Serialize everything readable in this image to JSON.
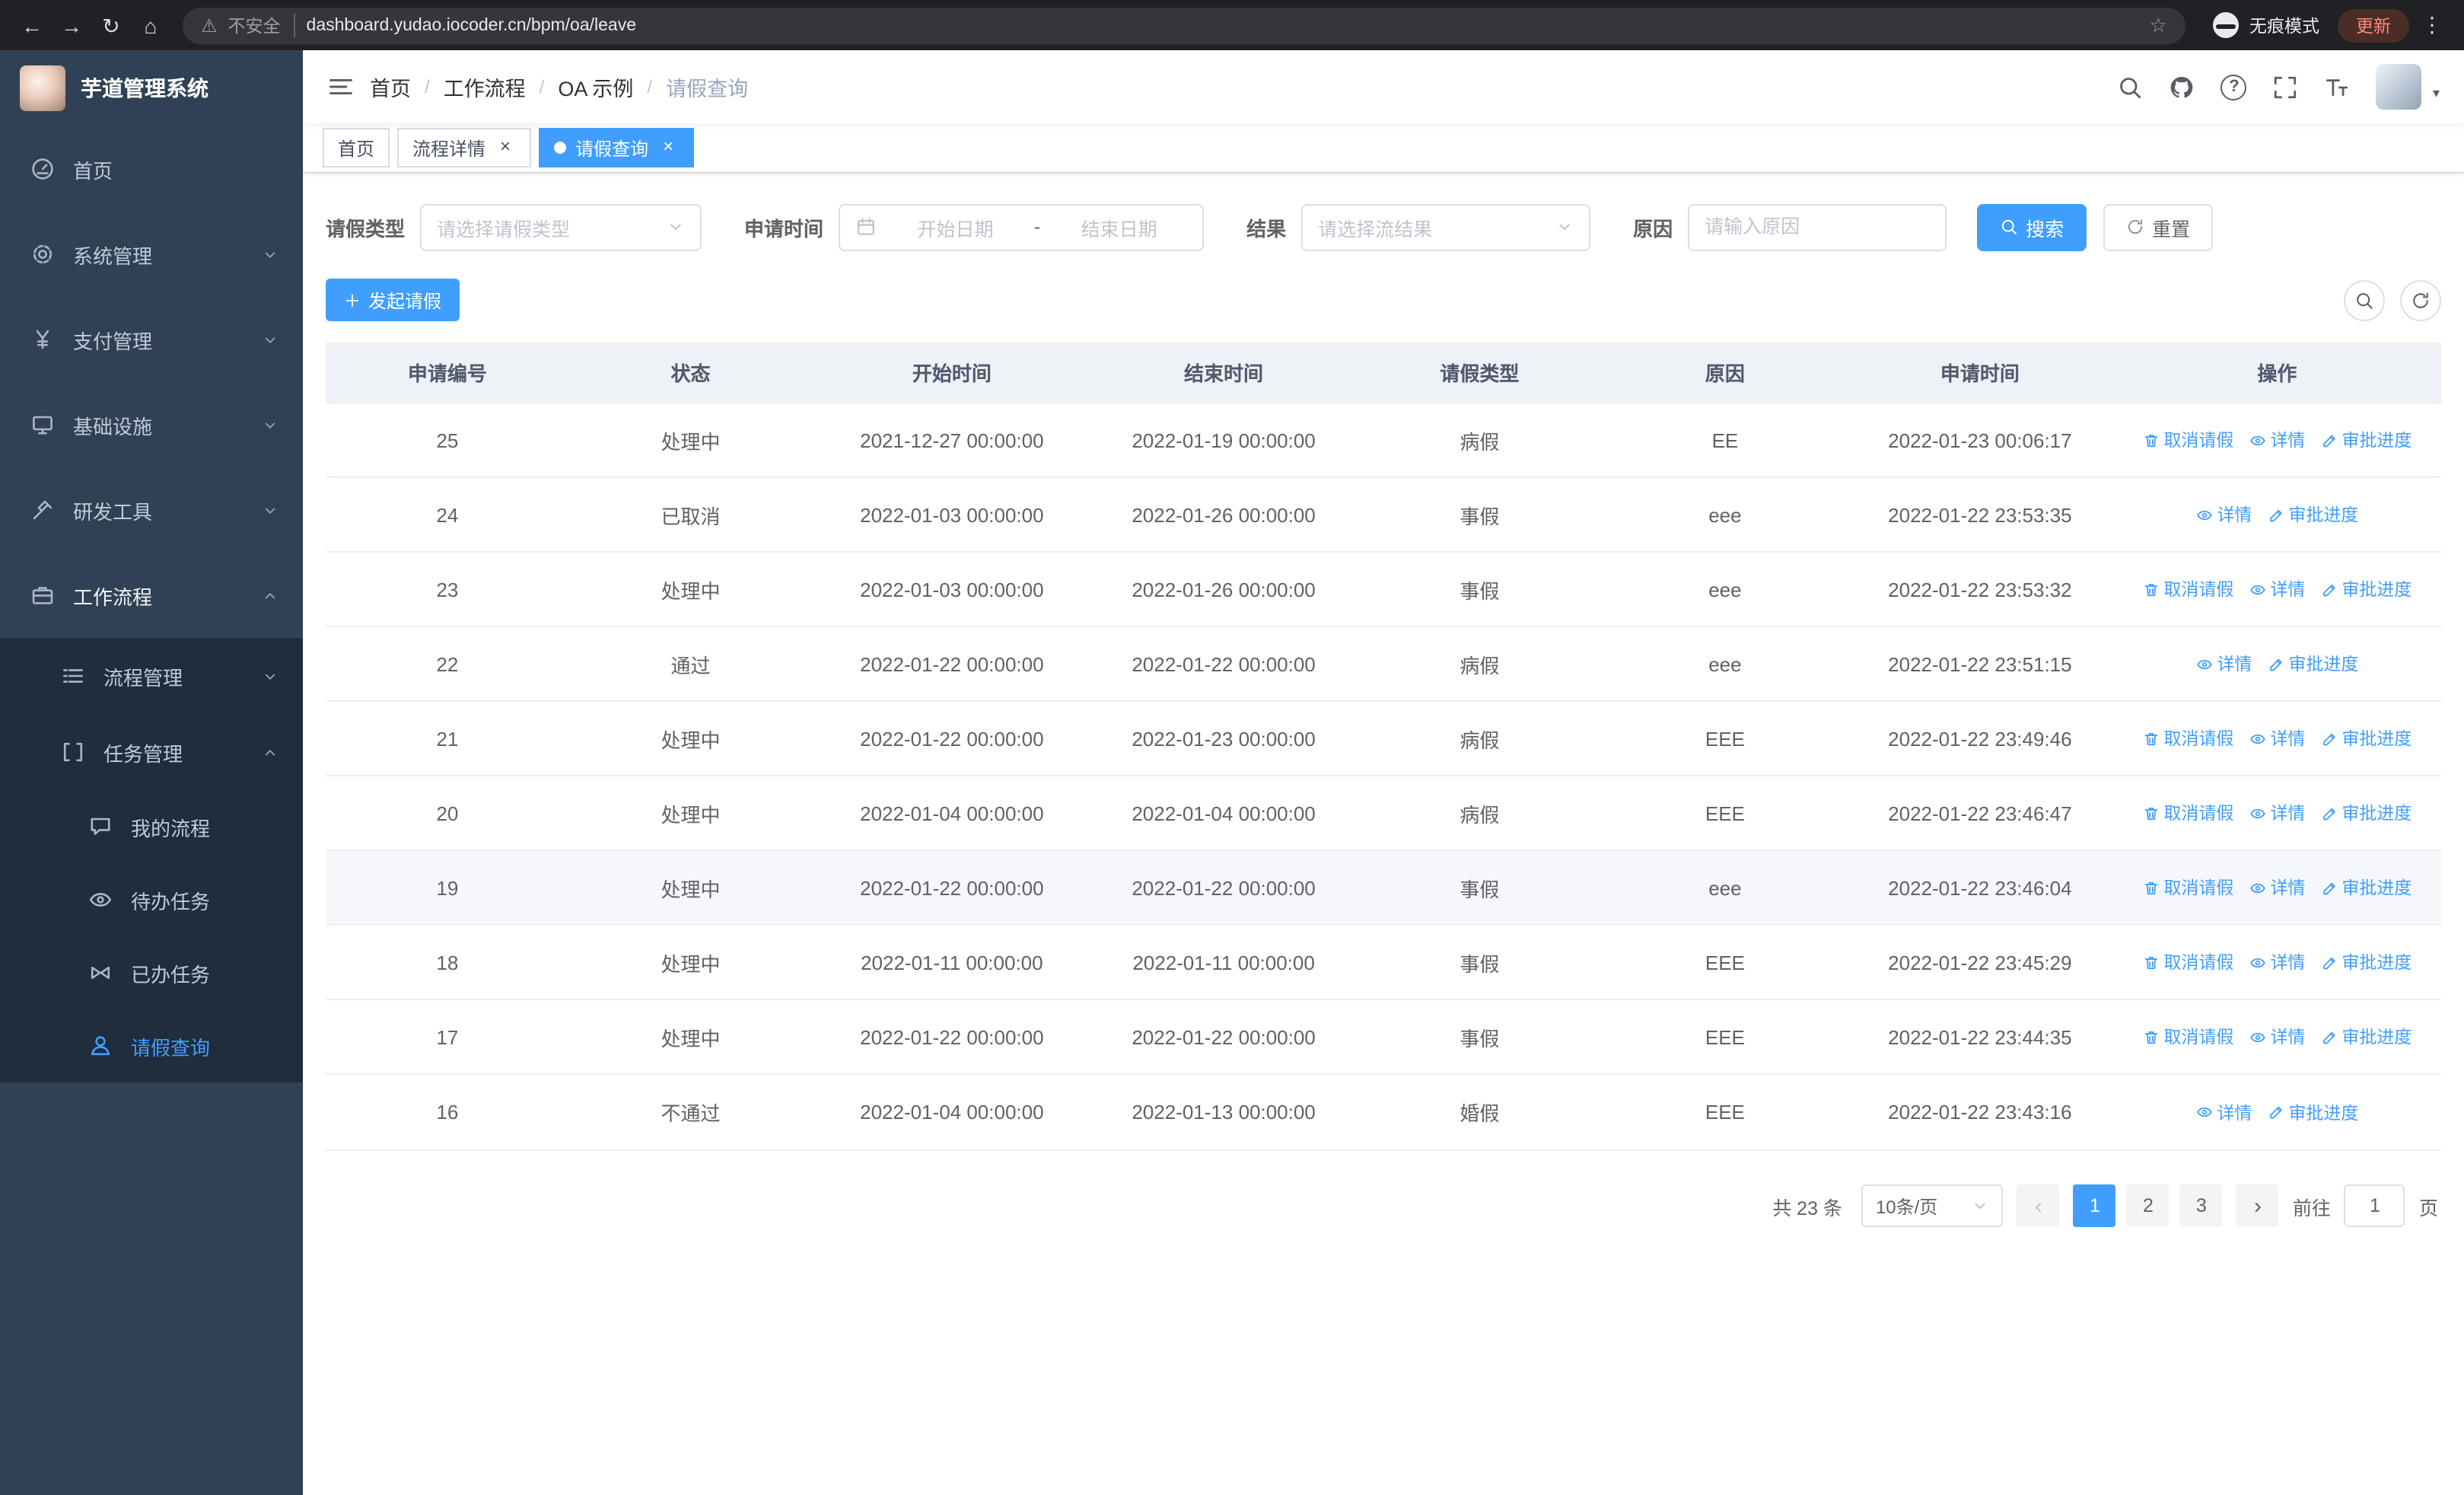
{
  "browser": {
    "security_warning": "不安全",
    "url": "dashboard.yudao.iocoder.cn/bpm/oa/leave",
    "incognito_label": "无痕模式",
    "update_button": "更新"
  },
  "sidebar": {
    "logo_title": "芋道管理系统",
    "menu": [
      {
        "key": "home",
        "label": "首页",
        "icon": "dashboard-icon"
      },
      {
        "key": "system-management",
        "label": "系统管理",
        "icon": "gear-icon",
        "chevron": "down"
      },
      {
        "key": "payment-management",
        "label": "支付管理",
        "icon": "yen-icon",
        "chevron": "down"
      },
      {
        "key": "infrastructure",
        "label": "基础设施",
        "icon": "monitor-icon",
        "chevron": "down"
      },
      {
        "key": "dev-tools",
        "label": "研发工具",
        "icon": "tools-icon",
        "chevron": "down"
      },
      {
        "key": "workflow",
        "label": "工作流程",
        "icon": "briefcase-icon",
        "chevron": "up",
        "highlight": true,
        "children": [
          {
            "key": "process-management",
            "label": "流程管理",
            "icon": "list-icon",
            "chevron": "down"
          },
          {
            "key": "task-management",
            "label": "任务管理",
            "icon": "bracket-icon",
            "chevron": "up",
            "children": [
              {
                "key": "my-process",
                "label": "我的流程",
                "icon": "chat-icon"
              },
              {
                "key": "todo-tasks",
                "label": "待办任务",
                "icon": "eye-icon"
              },
              {
                "key": "done-tasks",
                "label": "已办任务",
                "icon": "bowtie-icon"
              },
              {
                "key": "leave-query",
                "label": "请假查询",
                "icon": "user-icon",
                "active": true
              }
            ]
          }
        ]
      }
    ]
  },
  "header": {
    "breadcrumb": [
      "首页",
      "工作流程",
      "OA 示例",
      "请假查询"
    ]
  },
  "tabs": [
    {
      "key": "home",
      "label": "首页",
      "active": false,
      "closable": false
    },
    {
      "key": "process-detail",
      "label": "流程详情",
      "active": false,
      "closable": true
    },
    {
      "key": "leave-query",
      "label": "请假查询",
      "active": true,
      "closable": true
    }
  ],
  "filters": {
    "leave_type_label": "请假类型",
    "leave_type_placeholder": "请选择请假类型",
    "apply_time_label": "申请时间",
    "date_start_placeholder": "开始日期",
    "date_separator": "-",
    "date_end_placeholder": "结束日期",
    "result_label": "结果",
    "result_placeholder": "请选择流结果",
    "reason_label": "原因",
    "reason_placeholder": "请输入原因",
    "search_button": "搜索",
    "reset_button": "重置"
  },
  "toolbar": {
    "create_button": "发起请假"
  },
  "table": {
    "columns": [
      "申请编号",
      "状态",
      "开始时间",
      "结束时间",
      "请假类型",
      "原因",
      "申请时间",
      "操作"
    ],
    "action_labels": {
      "cancel": "取消请假",
      "detail": "详情",
      "progress": "审批进度"
    },
    "rows": [
      {
        "id": "25",
        "status": "处理中",
        "start": "2021-12-27 00:00:00",
        "end": "2022-01-19 00:00:00",
        "type": "病假",
        "reason": "EE",
        "apply_time": "2022-01-23 00:06:17",
        "actions": [
          "cancel",
          "detail",
          "progress"
        ]
      },
      {
        "id": "24",
        "status": "已取消",
        "start": "2022-01-03 00:00:00",
        "end": "2022-01-26 00:00:00",
        "type": "事假",
        "reason": "eee",
        "apply_time": "2022-01-22 23:53:35",
        "actions": [
          "detail",
          "progress"
        ]
      },
      {
        "id": "23",
        "status": "处理中",
        "start": "2022-01-03 00:00:00",
        "end": "2022-01-26 00:00:00",
        "type": "事假",
        "reason": "eee",
        "apply_time": "2022-01-22 23:53:32",
        "actions": [
          "cancel",
          "detail",
          "progress"
        ]
      },
      {
        "id": "22",
        "status": "通过",
        "start": "2022-01-22 00:00:00",
        "end": "2022-01-22 00:00:00",
        "type": "病假",
        "reason": "eee",
        "apply_time": "2022-01-22 23:51:15",
        "actions": [
          "detail",
          "progress"
        ]
      },
      {
        "id": "21",
        "status": "处理中",
        "start": "2022-01-22 00:00:00",
        "end": "2022-01-23 00:00:00",
        "type": "病假",
        "reason": "EEE",
        "apply_time": "2022-01-22 23:49:46",
        "actions": [
          "cancel",
          "detail",
          "progress"
        ]
      },
      {
        "id": "20",
        "status": "处理中",
        "start": "2022-01-04 00:00:00",
        "end": "2022-01-04 00:00:00",
        "type": "病假",
        "reason": "EEE",
        "apply_time": "2022-01-22 23:46:47",
        "actions": [
          "cancel",
          "detail",
          "progress"
        ]
      },
      {
        "id": "19",
        "status": "处理中",
        "start": "2022-01-22 00:00:00",
        "end": "2022-01-22 00:00:00",
        "type": "事假",
        "reason": "eee",
        "apply_time": "2022-01-22 23:46:04",
        "actions": [
          "cancel",
          "detail",
          "progress"
        ],
        "hover": true
      },
      {
        "id": "18",
        "status": "处理中",
        "start": "2022-01-11 00:00:00",
        "end": "2022-01-11 00:00:00",
        "type": "事假",
        "reason": "EEE",
        "apply_time": "2022-01-22 23:45:29",
        "actions": [
          "cancel",
          "detail",
          "progress"
        ]
      },
      {
        "id": "17",
        "status": "处理中",
        "start": "2022-01-22 00:00:00",
        "end": "2022-01-22 00:00:00",
        "type": "事假",
        "reason": "EEE",
        "apply_time": "2022-01-22 23:44:35",
        "actions": [
          "cancel",
          "detail",
          "progress"
        ]
      },
      {
        "id": "16",
        "status": "不通过",
        "start": "2022-01-04 00:00:00",
        "end": "2022-01-13 00:00:00",
        "type": "婚假",
        "reason": "EEE",
        "apply_time": "2022-01-22 23:43:16",
        "actions": [
          "detail",
          "progress"
        ]
      }
    ]
  },
  "pagination": {
    "total": "共 23 条",
    "page_size": "10条/页",
    "prev_icon": "‹",
    "next_icon": "›",
    "pages": [
      "1",
      "2",
      "3"
    ],
    "current_page": "1",
    "goto_label": "前往",
    "goto_value": "1",
    "page_suffix": "页"
  },
  "colors": {
    "primary": "#409eff",
    "sidebar_bg": "#304156",
    "submenu_bg": "#1f2d3d",
    "table_header_bg": "#eef1f6",
    "browser_bg": "#202124"
  }
}
